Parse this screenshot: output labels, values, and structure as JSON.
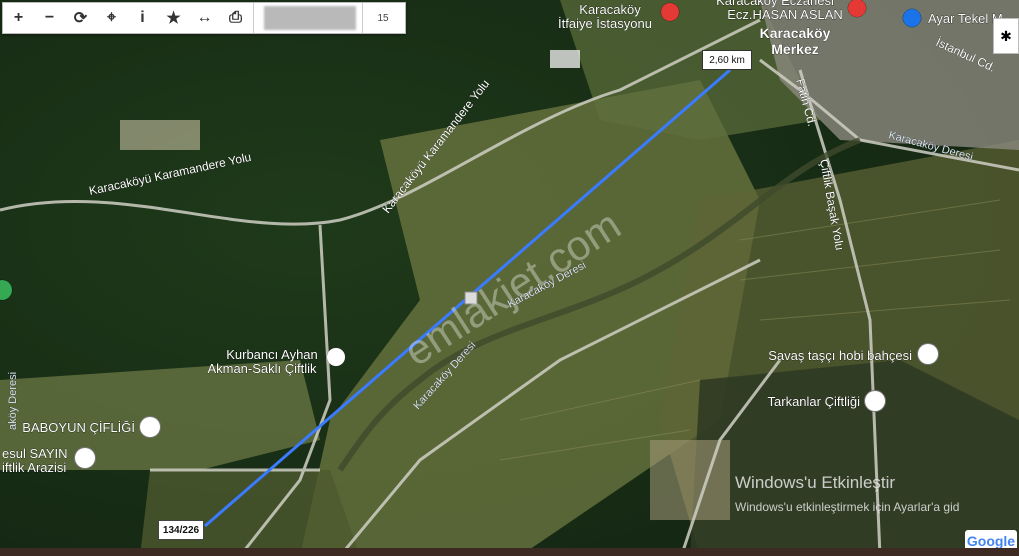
{
  "toolbar": {
    "buttons": [
      {
        "name": "zoom-in-button",
        "glyph": "+"
      },
      {
        "name": "zoom-out-button",
        "glyph": "−"
      },
      {
        "name": "refresh-button",
        "glyph": "⟳"
      },
      {
        "name": "locate-button",
        "glyph": "⌖"
      },
      {
        "name": "info-button",
        "glyph": "i"
      },
      {
        "name": "favorite-button",
        "glyph": "★"
      },
      {
        "name": "measure-button",
        "glyph": "↔"
      },
      {
        "name": "print-button",
        "glyph": "⎙"
      }
    ],
    "zoom_level": "15"
  },
  "measurement": {
    "distance": "2,60 km",
    "parcel": "134/226"
  },
  "labels": {
    "itfaiye": [
      "Karacaköy",
      "İtfaiye İstasyonu"
    ],
    "eczane": [
      "Karacaköy Eczanesi",
      "Ecz.HASAN ASLAN"
    ],
    "ayar": "Ayar Tekel M",
    "merkez": [
      "Karacaköy",
      "Merkez"
    ],
    "istanbul_cd": "İstanbul Cd.",
    "fatih_cd": "Fatih Cd.",
    "karacakoy_deresi_1": "Karacaköy Deresi",
    "karacakoy_deresi_2": "Karacaköy Deresi",
    "karacakoy_deresi_3": "Karacaköy Deresi",
    "karamandere_1": "Karacaköyü Karamandere Yolu",
    "karamandere_2": "Karacaköyü Karamandere Yolu",
    "ciftlik_basak": "Çiftlik Başak Yolu",
    "kurbanci": [
      "Kurbancı Ayhan",
      "Akman-Saklı Çiftlik"
    ],
    "savas": "Savaş taşçı hobi bahçesi",
    "tarkanlar": "Tarkanlar Çiftliği",
    "baboyun": "BABOYUN ÇİFLİĞİ",
    "resul": [
      "esul SAYIN",
      "iftlik Arazisi"
    ],
    "akoy_deresi": "aköy Deresi",
    "watermark": "emlakjet.com"
  },
  "windows_notice": {
    "title": "Windows'u Etkinleştir",
    "subtitle": "Windows'u etkinleştirmek için Ayarlar'a gid"
  },
  "google": "Google",
  "colors": {
    "route": "#3a7bff",
    "poi_red": "#e53935",
    "poi_blue": "#1a73e8"
  }
}
